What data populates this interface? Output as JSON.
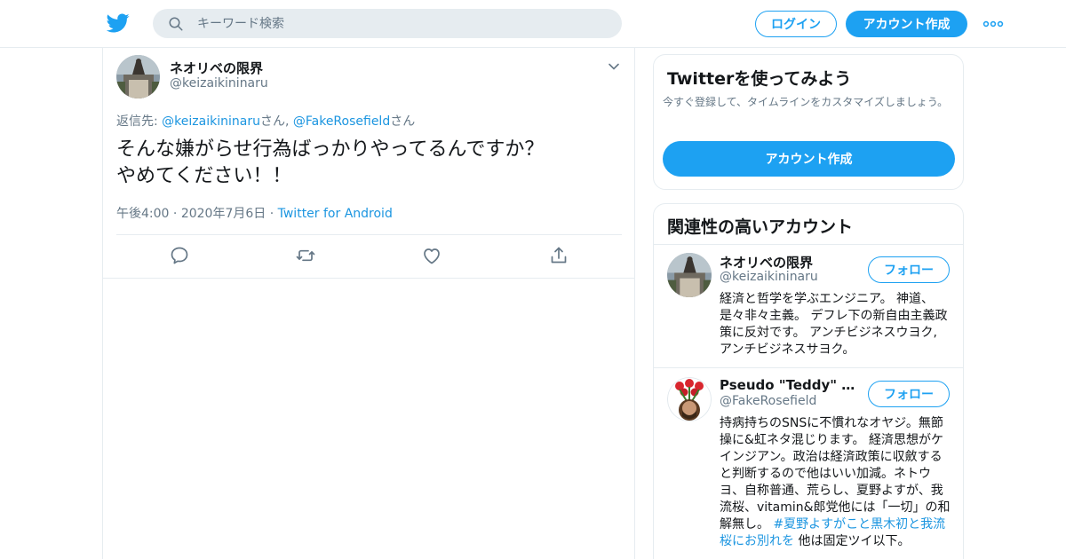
{
  "header": {
    "search_placeholder": "キーワード検索",
    "login_label": "ログイン",
    "signup_label": "アカウント作成"
  },
  "tweet": {
    "author_name": "ネオリベの限界",
    "author_handle": "@keizaikininaru",
    "reply_prefix": "返信先: ",
    "reply_mention_1": "@keizaikininaru",
    "reply_suffix_1": "さん, ",
    "reply_mention_2": "@FakeRosefield",
    "reply_suffix_2": "さん",
    "text": "そんな嫌がらせ行為ばっかりやってるんですか？\nやめてください！！",
    "time": "午後4:00",
    "date": "2020年7月6日",
    "source": "Twitter for Android",
    "sep": "·"
  },
  "sidebar": {
    "signup_card": {
      "title": "Twitterを使ってみよう",
      "description": "今すぐ登録して、タイムラインをカスタマイズしましょう。",
      "button": "アカウント作成"
    },
    "related": {
      "title": "関連性の高いアカウント",
      "follow_label": "フォロー",
      "accounts": [
        {
          "name": "ネオリベの限界",
          "handle": "@keizaikininaru",
          "bio": "経済と哲学を学ぶエンジニア。 神道、是々非々主義。 デフレ下の新自由主義政策に反対です。 アンチビジネスウヨク, アンチビジネスサヨク。"
        },
        {
          "name": "Pseudo \"Teddy\" Rosefield",
          "handle": "@FakeRosefield",
          "bio": "持病持ちのSNSに不慣れなオヤジ。無節操に&虹ネタ混じります。 経済思想がケインジアン。政治は経済政策に収斂すると判断するので他はいい加減。ネトウヨ、自称普通、荒らし、夏野よすが、我流桜、vitamin&郎党他には「一切」の和解無し。 ",
          "bio_tag": "#夏野よすがこと黒木初と我流桜にお別れを",
          "bio_end": " 他は固定ツイ以下。"
        }
      ]
    }
  },
  "colors": {
    "brand": "#1da1f2",
    "link": "#1b95e0",
    "secondary_text": "#657786",
    "border": "#e6ecf0"
  },
  "icons": [
    "twitter-bird-icon",
    "search-icon",
    "more-dots-icon",
    "chevron-down-icon",
    "reply-icon",
    "retweet-icon",
    "like-icon",
    "share-icon"
  ]
}
